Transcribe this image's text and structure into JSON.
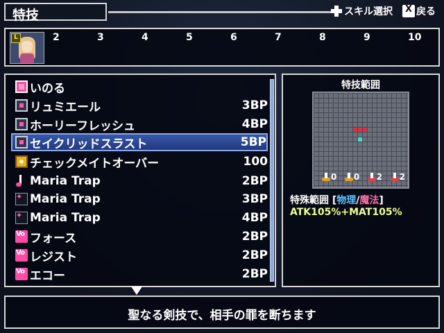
{
  "header": {
    "title": "特技",
    "hint_skill_select": "スキル選択",
    "hint_back": "戻る",
    "x_key": "X"
  },
  "party": {
    "slots": [
      "2",
      "3",
      "4",
      "5",
      "6",
      "7",
      "8",
      "9",
      "10"
    ],
    "portrait_badge": "L"
  },
  "skills": [
    {
      "name": "いのる",
      "cost": "",
      "icon": "pink-square-icon"
    },
    {
      "name": "リュミエール",
      "cost": "3BP",
      "icon": "square-skill-icon"
    },
    {
      "name": "ホーリーフレッシュ",
      "cost": "4BP",
      "icon": "square-skill-icon"
    },
    {
      "name": "セイクリッドスラスト",
      "cost": "5BP",
      "icon": "square-skill-icon",
      "selected": true
    },
    {
      "name": "チェックメイトオーバー",
      "cost": "100",
      "icon": "gold-skill-icon"
    },
    {
      "name": "Maria Trap",
      "cost": "2BP",
      "icon": "note-icon"
    },
    {
      "name": "Maria Trap",
      "cost": "3BP",
      "icon": "sparkle-icon"
    },
    {
      "name": "Maria Trap",
      "cost": "4BP",
      "icon": "sparkle-icon"
    },
    {
      "name": "フォース",
      "cost": "2BP",
      "icon": "vo-icon"
    },
    {
      "name": "レジスト",
      "cost": "2BP",
      "icon": "vo-icon"
    },
    {
      "name": "エコー",
      "cost": "2BP",
      "icon": "vo-icon"
    }
  ],
  "range_panel": {
    "title": "特技範囲",
    "stats": [
      "0",
      "0",
      "2",
      "2"
    ],
    "type_label": "特殊範囲",
    "bracket_open": "[",
    "physical": "物理",
    "slash": "/",
    "magic": "魔法",
    "bracket_close": "]",
    "formula": "ATK105%+MAT105%"
  },
  "description": "聖なる剣技で、相手の罪を断ちます"
}
